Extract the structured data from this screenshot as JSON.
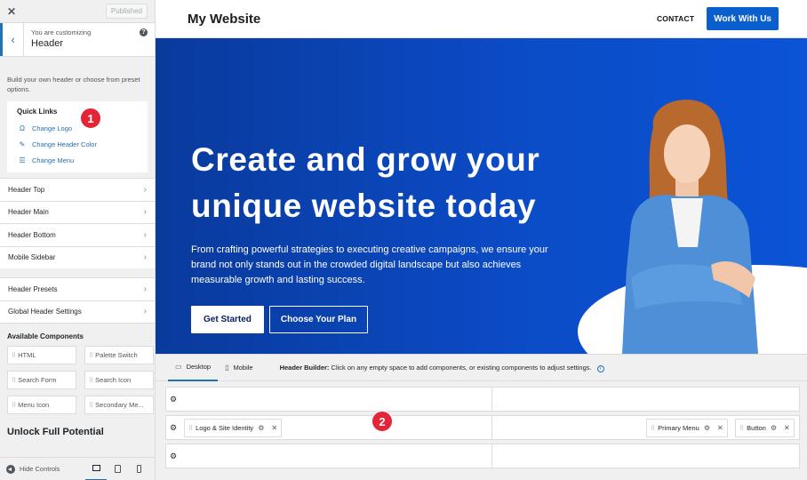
{
  "sidebar": {
    "close_glyph": "✕",
    "published_label": "Published",
    "customizing_label": "You are customizing",
    "section_title": "Header",
    "help_glyph": "?",
    "description": "Build your own header or choose from preset options.",
    "quick_links": {
      "title": "Quick Links",
      "items": [
        {
          "label": "Change Logo",
          "icon": "logo-icon"
        },
        {
          "label": "Change Header Color",
          "icon": "brush-icon"
        },
        {
          "label": "Change Menu",
          "icon": "menu-icon"
        }
      ]
    },
    "rows": [
      {
        "label": "Header Top"
      },
      {
        "label": "Header Main"
      },
      {
        "label": "Header Bottom"
      },
      {
        "label": "Mobile Sidebar"
      }
    ],
    "rows2": [
      {
        "label": "Header Presets"
      },
      {
        "label": "Global Header Settings"
      }
    ],
    "available_title": "Available Components",
    "components": [
      {
        "label": "HTML"
      },
      {
        "label": "Palette Switch"
      },
      {
        "label": "Search Form"
      },
      {
        "label": "Search Icon"
      },
      {
        "label": "Menu Icon"
      },
      {
        "label": "Secondary Me..."
      }
    ],
    "unlock_title": "Unlock Full Potential",
    "hide_controls": "Hide Controls"
  },
  "markers": [
    "1",
    "2"
  ],
  "site": {
    "logo": "My Website",
    "nav_link": "CONTACT",
    "nav_button": "Work With Us",
    "hero_title": "Create and grow your unique website today",
    "hero_text": "From crafting powerful strategies to executing creative campaigns, we ensure your brand not only stands out in the crowded digital landscape but also achieves measurable growth and lasting success.",
    "btn_primary": "Get Started",
    "btn_secondary": "Choose Your Plan"
  },
  "builder": {
    "tabs": [
      {
        "label": "Desktop",
        "icon": "desktop-icon"
      },
      {
        "label": "Mobile",
        "icon": "mobile-icon"
      }
    ],
    "desc_bold": "Header Builder:",
    "desc_text": "Click on any empty space to add components, or existing components to adjust settings.",
    "chips": {
      "logo": "Logo & Site Identity",
      "menu": "Primary Menu",
      "button": "Button"
    }
  },
  "colors": {
    "accent": "#2271b1",
    "hero_blue": "#0b4bc6",
    "brand_button": "#0b5fcc",
    "marker_red": "#e52438"
  }
}
